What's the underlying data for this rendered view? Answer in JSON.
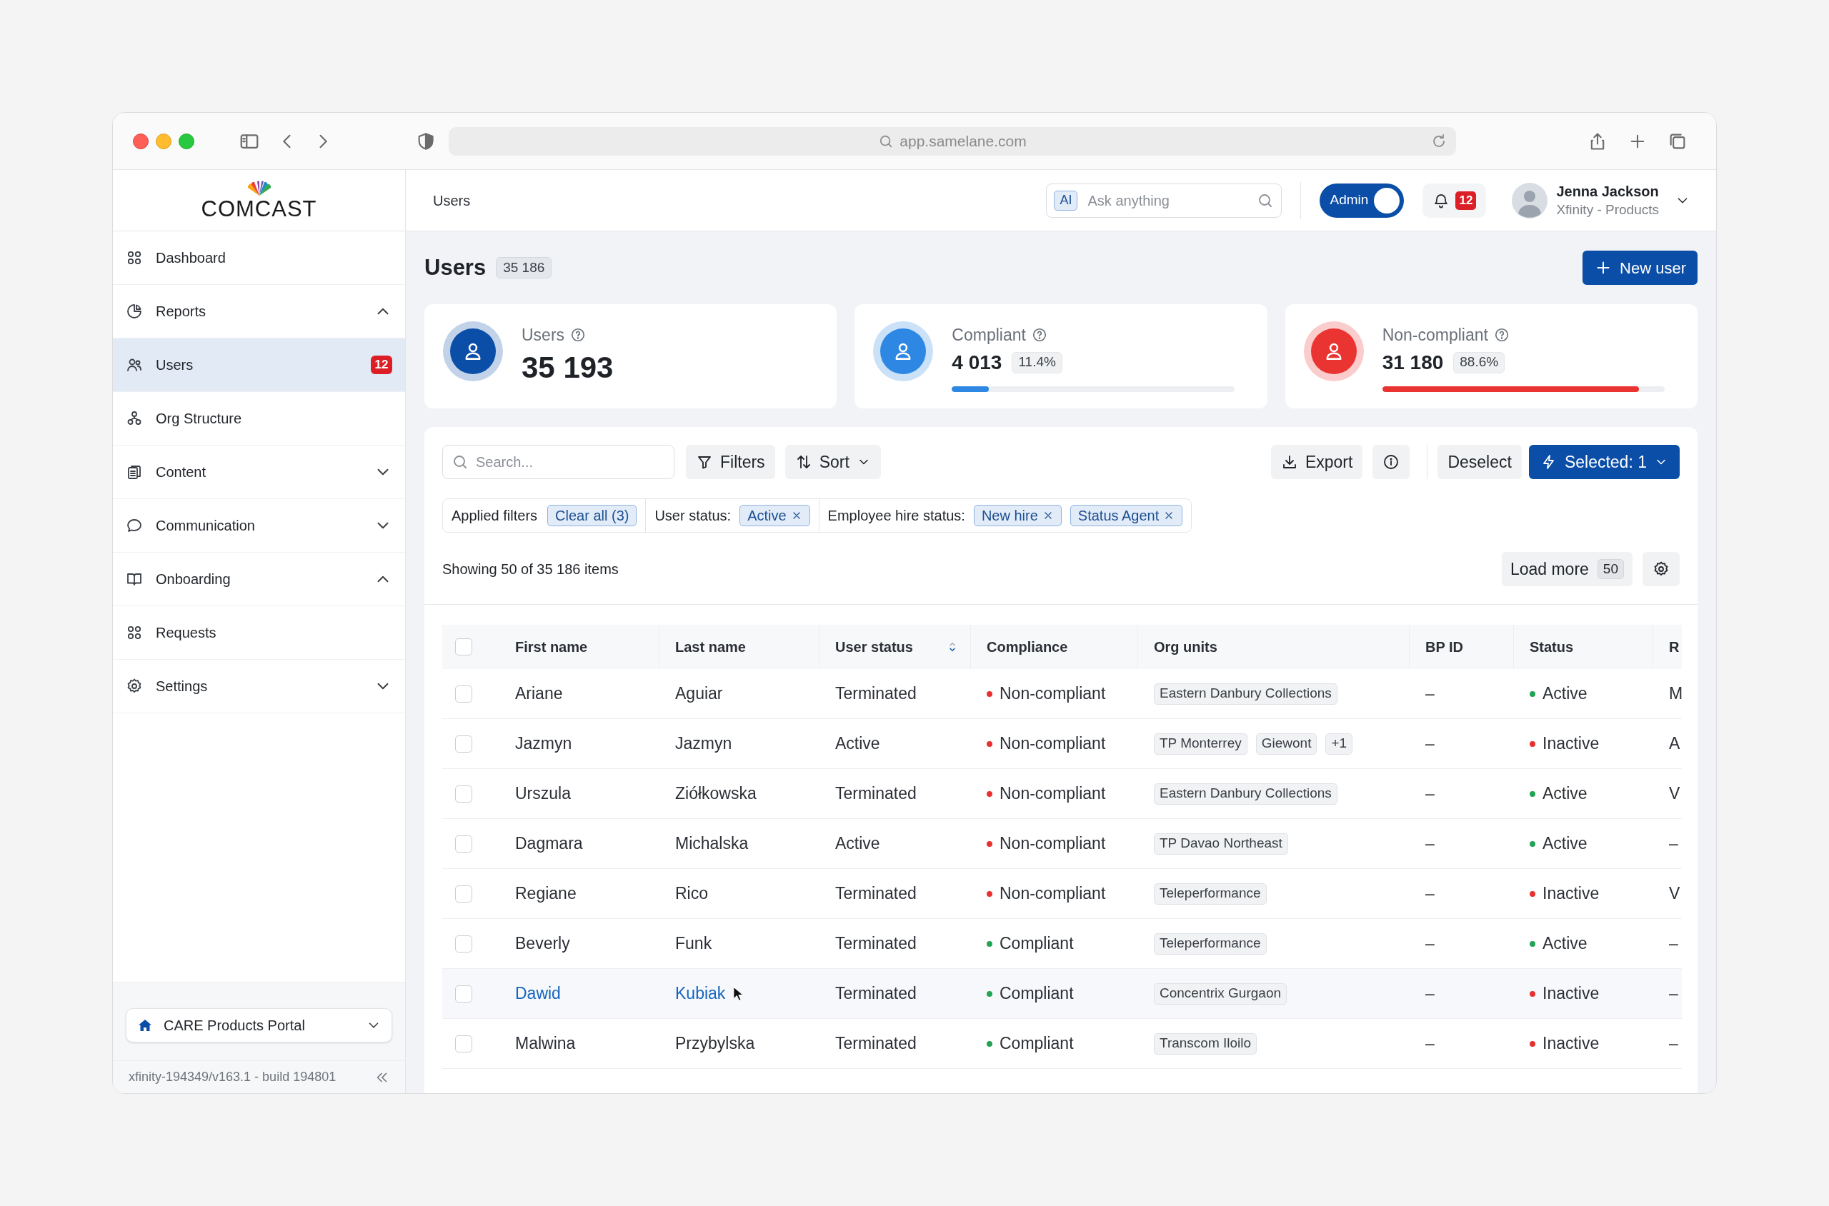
{
  "browser": {
    "url": "app.samelane.com"
  },
  "brand": {
    "logo_text": "COMCAST"
  },
  "sidebar": {
    "items": [
      {
        "label": "Dashboard",
        "kind": "link",
        "selected": false
      },
      {
        "label": "Reports",
        "kind": "group",
        "expanded": true,
        "selected": false
      },
      {
        "label": "Users",
        "kind": "link",
        "selected": true,
        "badge": "12"
      },
      {
        "label": "Org Structure",
        "kind": "link",
        "selected": false
      },
      {
        "label": "Content",
        "kind": "group",
        "expanded": false,
        "selected": false
      },
      {
        "label": "Communication",
        "kind": "group",
        "expanded": false,
        "selected": false
      },
      {
        "label": "Onboarding",
        "kind": "group",
        "expanded": true,
        "selected": false
      },
      {
        "label": "Requests",
        "kind": "link",
        "selected": false
      },
      {
        "label": "Settings",
        "kind": "group",
        "expanded": false,
        "selected": false
      }
    ],
    "portal": "CARE Products Portal",
    "version": "xfinity-194349/v163.1 - build 194801"
  },
  "header": {
    "breadcrumb": "Users",
    "ai_search": {
      "badge": "AI",
      "placeholder": "Ask anything"
    },
    "admin_toggle": {
      "label": "Admin",
      "on": true
    },
    "notifications": {
      "count": "12"
    },
    "user": {
      "name": "Jenna Jackson",
      "org": "Xfinity - Products"
    }
  },
  "page": {
    "title": "Users",
    "count": "35 186",
    "new_button": "New user"
  },
  "stats": [
    {
      "title": "Users",
      "value": "35 193",
      "color": "#0b4ea8"
    },
    {
      "title": "Compliant",
      "value": "4 013",
      "percent": "11.4%",
      "level": 0.13,
      "color": "#2d87e3"
    },
    {
      "title": "Non-compliant",
      "value": "31 180",
      "percent": "88.6%",
      "level": 0.91,
      "color": "#ea3431"
    }
  ],
  "toolbar": {
    "search_placeholder": "Search...",
    "filters": "Filters",
    "sort": "Sort",
    "export": "Export",
    "deselect": "Deselect",
    "selected": "Selected: 1"
  },
  "applied_filters": {
    "label": "Applied filters",
    "clear": "Clear all (3)",
    "groups": [
      {
        "label": "User status:",
        "chips": [
          "Active"
        ]
      },
      {
        "label": "Employee hire status:",
        "chips": [
          "New hire",
          "Status Agent"
        ]
      }
    ]
  },
  "summary": {
    "showing": "Showing 50 of 35 186 items",
    "load_more": "Load more",
    "load_count": "50"
  },
  "table": {
    "select_all_checked": false,
    "columns": [
      {
        "label": "First name"
      },
      {
        "label": "Last name"
      },
      {
        "label": "User status",
        "sortable": true
      },
      {
        "label": "Compliance"
      },
      {
        "label": "Org units"
      },
      {
        "label": "BP ID"
      },
      {
        "label": "Status"
      },
      {
        "label": "R"
      }
    ],
    "rows": [
      {
        "checked": false,
        "hovered": false,
        "first": "Ariane",
        "last": "Aguiar",
        "user_status": "Terminated",
        "compliance": {
          "text": "Non-compliant",
          "color": "#e5322f"
        },
        "org_units": [
          "Eastern Danbury Collections"
        ],
        "bp_id": "–",
        "status": {
          "text": "Active",
          "color": "#22a454"
        },
        "column_8": "M"
      },
      {
        "checked": false,
        "hovered": false,
        "first": "Jazmyn",
        "last": "Jazmyn",
        "user_status": "Active",
        "compliance": {
          "text": "Non-compliant",
          "color": "#e5322f"
        },
        "org_units": [
          "TP Monterrey",
          "Giewont",
          "+1"
        ],
        "bp_id": "–",
        "status": {
          "text": "Inactive",
          "color": "#e5322f"
        },
        "column_8": "A"
      },
      {
        "checked": false,
        "hovered": false,
        "first": "Urszula",
        "last": "Ziółkowska",
        "user_status": "Terminated",
        "compliance": {
          "text": "Non-compliant",
          "color": "#e5322f"
        },
        "org_units": [
          "Eastern Danbury Collections"
        ],
        "bp_id": "–",
        "status": {
          "text": "Active",
          "color": "#22a454"
        },
        "column_8": "V"
      },
      {
        "checked": false,
        "hovered": false,
        "first": "Dagmara",
        "last": "Michalska",
        "user_status": "Active",
        "compliance": {
          "text": "Non-compliant",
          "color": "#e5322f"
        },
        "org_units": [
          "TP Davao Northeast"
        ],
        "bp_id": "–",
        "status": {
          "text": "Active",
          "color": "#22a454"
        },
        "column_8": "–"
      },
      {
        "checked": false,
        "hovered": false,
        "first": "Regiane",
        "last": "Rico",
        "user_status": "Terminated",
        "compliance": {
          "text": "Non-compliant",
          "color": "#e5322f"
        },
        "org_units": [
          "Teleperformance"
        ],
        "bp_id": "–",
        "status": {
          "text": "Inactive",
          "color": "#e5322f"
        },
        "column_8": "V"
      },
      {
        "checked": false,
        "hovered": false,
        "first": "Beverly",
        "last": "Funk",
        "user_status": "Terminated",
        "compliance": {
          "text": "Compliant",
          "color": "#22a454"
        },
        "org_units": [
          "Teleperformance"
        ],
        "bp_id": "–",
        "status": {
          "text": "Active",
          "color": "#22a454"
        },
        "column_8": "–"
      },
      {
        "checked": false,
        "hovered": true,
        "first": "Dawid",
        "last": "Kubiak",
        "user_status": "Terminated",
        "compliance": {
          "text": "Compliant",
          "color": "#22a454"
        },
        "org_units": [
          "Concentrix Gurgaon"
        ],
        "bp_id": "–",
        "status": {
          "text": "Inactive",
          "color": "#e5322f"
        },
        "column_8": "–"
      },
      {
        "checked": false,
        "hovered": false,
        "first": "Malwina",
        "last": "Przybylska",
        "user_status": "Terminated",
        "compliance": {
          "text": "Compliant",
          "color": "#22a454"
        },
        "org_units": [
          "Transcom Iloilo"
        ],
        "bp_id": "–",
        "status": {
          "text": "Inactive",
          "color": "#e5322f"
        },
        "column_8": "–"
      }
    ]
  }
}
